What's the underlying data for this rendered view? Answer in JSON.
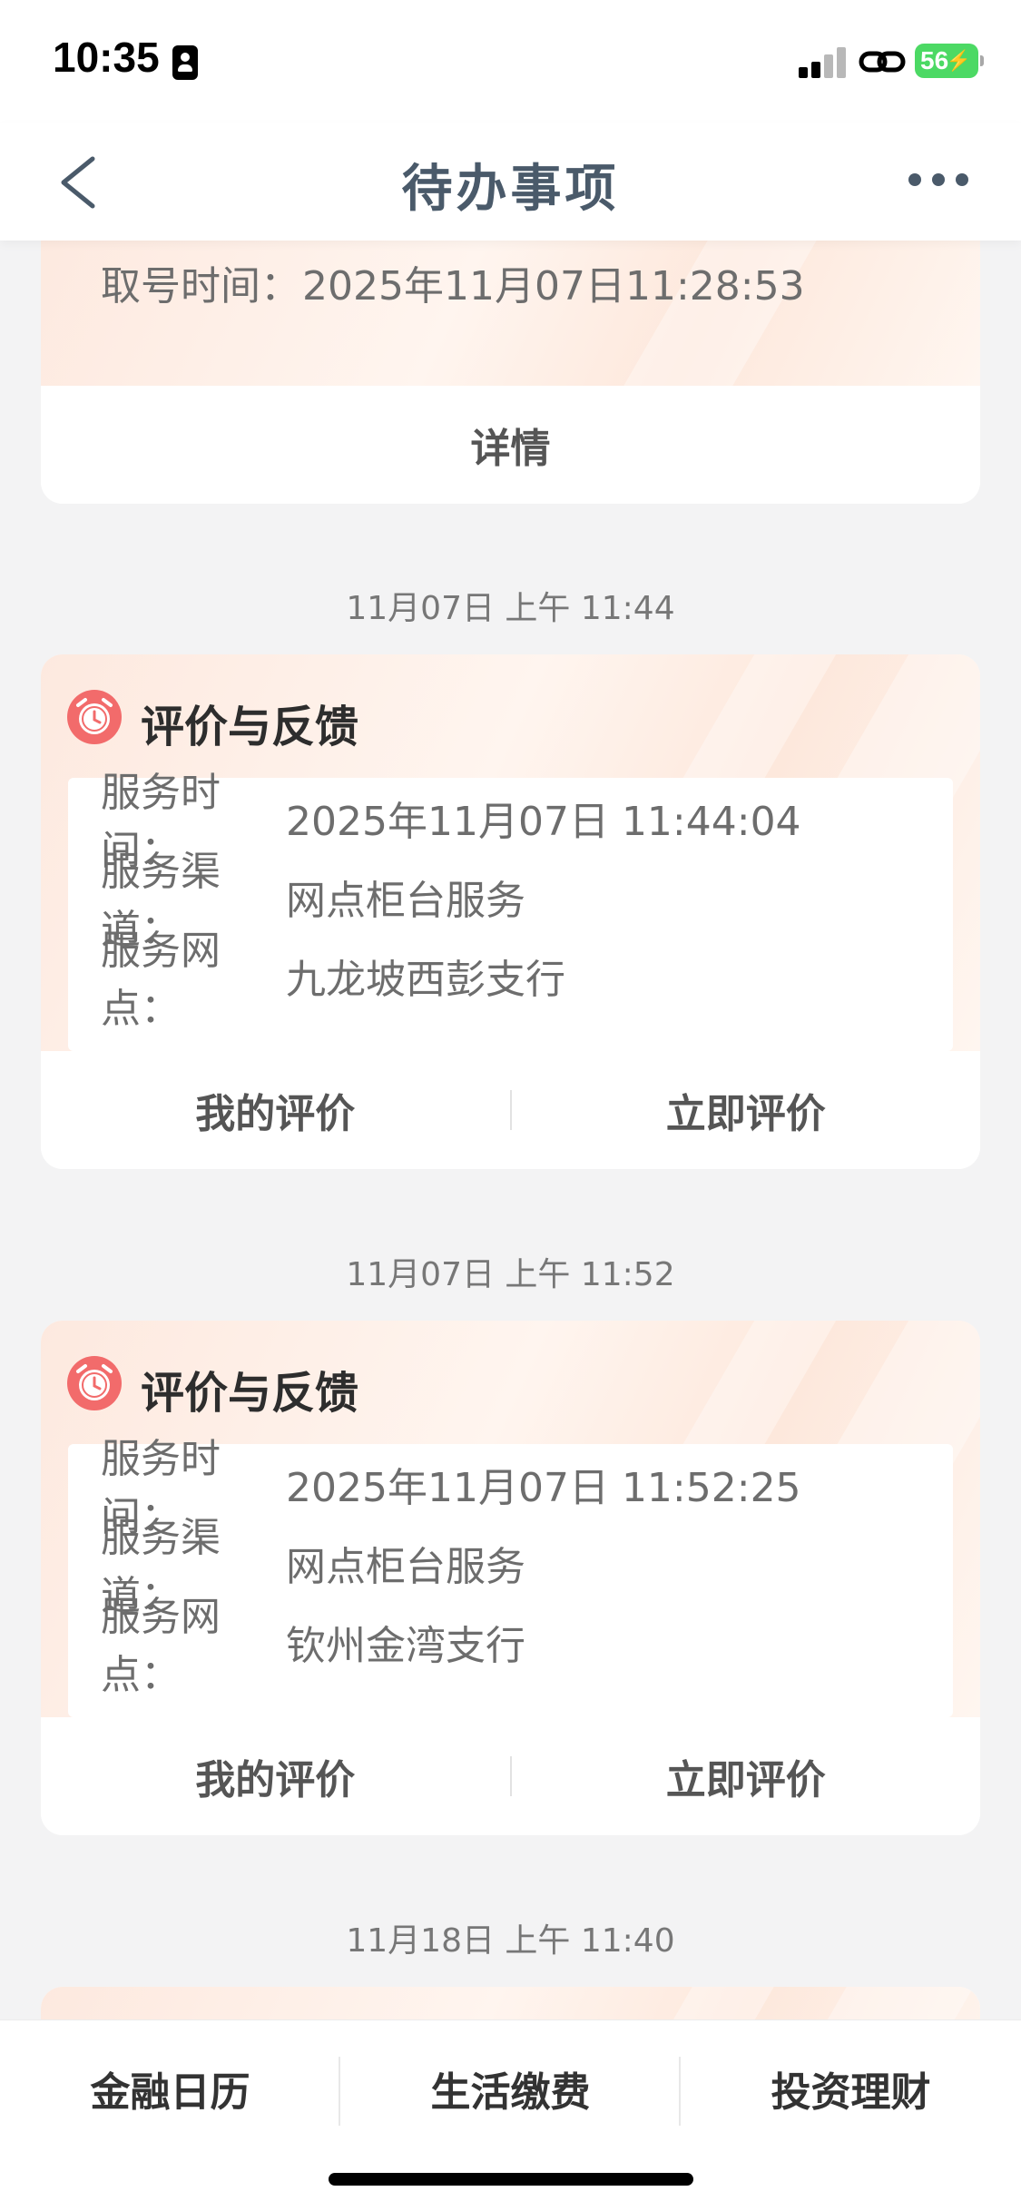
{
  "status_bar": {
    "time": "10:35",
    "battery": "56",
    "signal_icon": "cellular-signal-icon",
    "link_icon": "personal-hotspot-icon"
  },
  "nav": {
    "title": "待办事项",
    "back_icon": "chevron-left-icon",
    "more_icon": "more-dots-icon"
  },
  "cards": [
    {
      "partial": true,
      "rows": [
        {
          "label": "取号时间：",
          "value": "2025年11月07日11:28:53"
        }
      ],
      "actions": [
        {
          "label": "详情"
        }
      ]
    },
    {
      "timestamp": "11月07日 上午 11:44",
      "title": "评价与反馈",
      "icon": "alarm-clock-icon",
      "rows": [
        {
          "label": "服务时间：",
          "value": "2025年11月07日 11:44:04"
        },
        {
          "label": "服务渠道：",
          "value": "网点柜台服务"
        },
        {
          "label": "服务网点：",
          "value": "九龙坡西彭支行"
        }
      ],
      "actions": [
        {
          "label": "我的评价"
        },
        {
          "label": "立即评价"
        }
      ]
    },
    {
      "timestamp": "11月07日 上午 11:52",
      "title": "评价与反馈",
      "icon": "alarm-clock-icon",
      "rows": [
        {
          "label": "服务时间：",
          "value": "2025年11月07日 11:52:25"
        },
        {
          "label": "服务渠道：",
          "value": "网点柜台服务"
        },
        {
          "label": "服务网点：",
          "value": "钦州金湾支行"
        }
      ],
      "actions": [
        {
          "label": "我的评价"
        },
        {
          "label": "立即评价"
        }
      ]
    },
    {
      "timestamp": "11月18日 上午 11:40",
      "partial": true
    }
  ],
  "tabbar": {
    "tabs": [
      {
        "label": "金融日历"
      },
      {
        "label": "生活缴费"
      },
      {
        "label": "投资理财"
      }
    ]
  },
  "colors": {
    "accent_alarm": "#f26b6b",
    "nav_text": "#4a5a6a",
    "battery": "#4cd964",
    "page_bg": "#f3f3f4"
  }
}
